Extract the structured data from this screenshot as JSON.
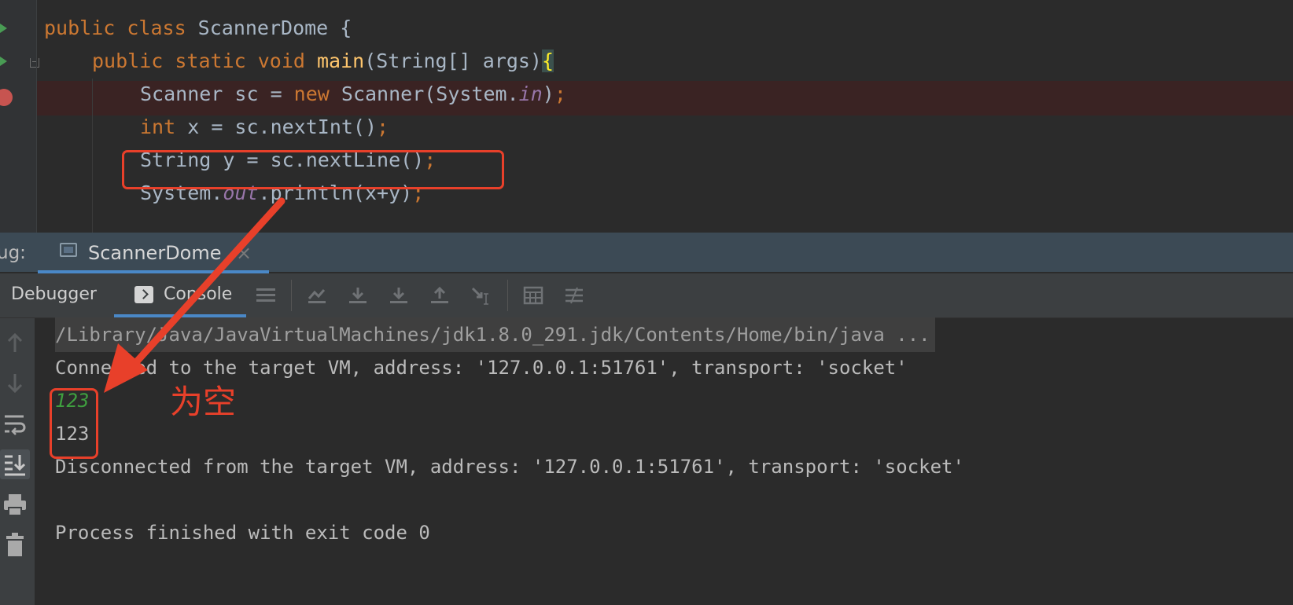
{
  "editor": {
    "code_lines": [
      {
        "parts": [
          [
            "kw",
            "public class "
          ],
          [
            "",
            "ScannerDome {"
          ]
        ]
      },
      {
        "parts": [
          [
            "kw",
            "public static void "
          ],
          [
            "fn",
            "main"
          ],
          [
            "",
            "(String[] args)"
          ],
          [
            "brace",
            "{"
          ]
        ]
      },
      {
        "parts": [
          [
            "",
            "Scanner sc = "
          ],
          [
            "kw",
            "new "
          ],
          [
            "",
            "Scanner(System."
          ],
          [
            "st",
            "in"
          ],
          [
            "",
            ")"
          ],
          [
            "kw",
            ";"
          ]
        ]
      },
      {
        "parts": [
          [
            "kw",
            "int "
          ],
          [
            "",
            "x = sc.nextInt()"
          ],
          [
            "kw",
            ";"
          ]
        ]
      },
      {
        "parts": [
          [
            "",
            "String y = sc.nextLine()"
          ],
          [
            "kw",
            ";"
          ]
        ]
      },
      {
        "parts": [
          [
            "",
            "System."
          ],
          [
            "st",
            "out"
          ],
          [
            "",
            ".println(x+y)"
          ],
          [
            "kw",
            ";"
          ]
        ]
      }
    ],
    "breakpoint_line": 3,
    "highlighted_line": 5
  },
  "debug_panel": {
    "title": "ug:",
    "session_tab": "ScannerDome",
    "close_symbol": "×",
    "tabs": {
      "debugger": "Debugger",
      "console": "Console"
    },
    "toolbar_icons": [
      "menu-icon",
      "show-execution-point-icon",
      "step-over-icon",
      "step-into-icon",
      "step-out-icon",
      "run-to-cursor-icon",
      "evaluate-expression-icon",
      "trace-settings-icon"
    ]
  },
  "console": {
    "command": "/Library/Java/JavaVirtualMachines/jdk1.8.0_291.jdk/Contents/Home/bin/java ...",
    "connected": "Connected to the target VM, address: '127.0.0.1:51761', transport: 'socket'",
    "user_input": "123",
    "program_output": "123",
    "disconnected": "Disconnected from the target VM, address: '127.0.0.1:51761', transport: 'socket'",
    "blank": "",
    "finished": "Process finished with exit code 0",
    "side_icons": [
      "arrow-up-icon",
      "arrow-down-icon",
      "soft-wrap-icon",
      "scroll-to-end-icon",
      "print-icon",
      "trash-icon"
    ]
  },
  "annotation": {
    "text": "为空",
    "color": "#e8402a"
  },
  "colors": {
    "keyword": "#cc7832",
    "function": "#ffc66d",
    "static_field": "#9876aa",
    "input_text": "#3f9f3f",
    "accent": "#4a88c7"
  }
}
